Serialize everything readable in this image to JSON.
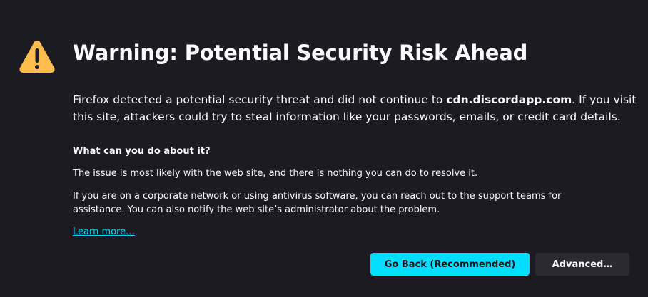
{
  "page": {
    "title": "Warning: Potential Security Risk Ahead",
    "intro_before": "Firefox detected a potential security threat and did not continue to ",
    "intro_host": "cdn.discordapp.com",
    "intro_after": ". If you visit this site, attackers could try to steal information like your passwords, emails, or credit card details.",
    "what_heading": "What can you do about it?",
    "paragraph_1": "The issue is most likely with the web site, and there is nothing you can do to resolve it.",
    "paragraph_2": "If you are on a corporate network or using antivirus software, you can reach out to the support teams for assistance. You can also notify the web site’s administrator about the problem.",
    "learn_more": "Learn more…"
  },
  "buttons": {
    "go_back": "Go Back (Recommended)",
    "advanced": "Advanced…"
  },
  "icons": {
    "warning": "warning-triangle-icon"
  },
  "colors": {
    "background": "#1c1b22",
    "accent": "#00ddff",
    "warning": "#ffbd4f",
    "secondary_button": "#2b2a33"
  }
}
